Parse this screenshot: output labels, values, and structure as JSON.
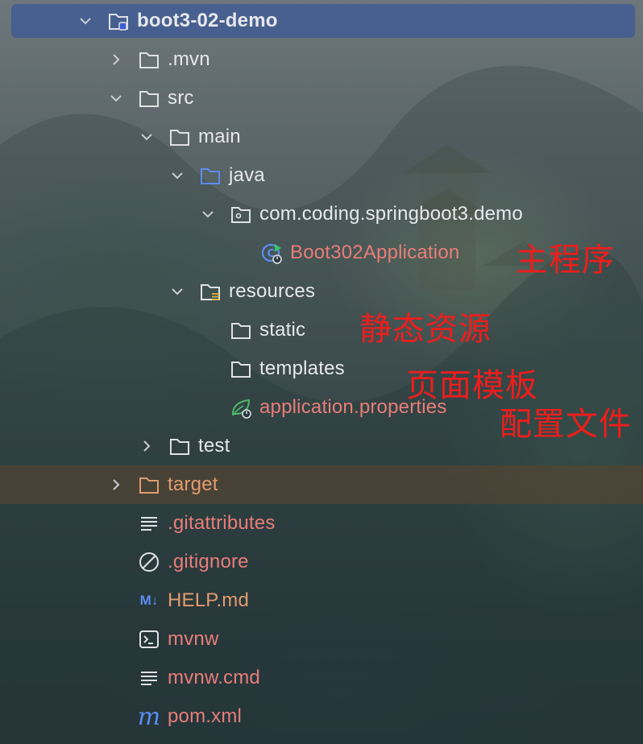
{
  "tree": {
    "root": "boot3-02-demo",
    "mvn": ".mvn",
    "src": "src",
    "main": "main",
    "java": "java",
    "package": "com.coding.springboot3.demo",
    "app_class": "Boot302Application",
    "resources": "resources",
    "static": "static",
    "templates": "templates",
    "app_props": "application.properties",
    "test": "test",
    "target": "target",
    "gitattributes": ".gitattributes",
    "gitignore": ".gitignore",
    "help_md": "HELP.md",
    "mvnw": "mvnw",
    "mvnw_cmd": "mvnw.cmd",
    "pom": "pom.xml"
  },
  "annotations": {
    "main_program": "主程序",
    "static_resources": "静态资源",
    "page_templates": "页面模板",
    "config_file": "配置文件"
  },
  "icons": {
    "help_md_badge": "M↓",
    "pom_badge": "m"
  },
  "colors": {
    "selection": "#3e5a96",
    "label_default": "#e6e8ec",
    "label_modified": "#e87d78",
    "label_excluded": "#e39b6d",
    "annotation": "#ee1d1d",
    "folder_source": "#5b8cf0"
  }
}
